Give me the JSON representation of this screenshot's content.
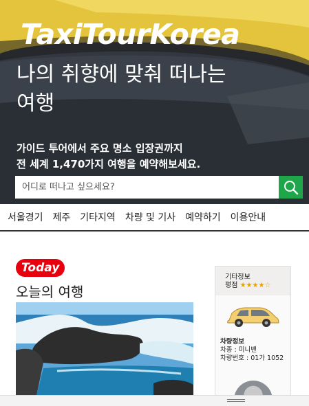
{
  "hero": {
    "brand": "TaxiTourKorea",
    "headline_line1": "나의 취향에 맞춰 떠나는",
    "headline_line2": "여행",
    "subline_line1": "가이드 투어에서 주요 명소 입장권까지",
    "subline_line2": "전 세계 1,470가지 여행을 예약해보세요."
  },
  "search": {
    "placeholder": "어디로 떠나고 싶으세요?",
    "button_icon": "search-icon"
  },
  "nav": {
    "items": [
      "서울경기",
      "제주",
      "기타지역",
      "차량 및 기사",
      "예약하기",
      "이용안내"
    ]
  },
  "main": {
    "badge": "Today",
    "title": "오늘의 여행"
  },
  "side": {
    "label": "기타정보",
    "rating_label": "평점",
    "stars": "★★★★☆",
    "vehicle_title": "차량정보",
    "vehicle_type": "차종 : 미니밴",
    "vehicle_number": "차량번호 : 01가 1052"
  },
  "colors": {
    "accent_green": "#1fa64a",
    "badge_red": "#e8000e",
    "star_gold": "#e2a300"
  }
}
